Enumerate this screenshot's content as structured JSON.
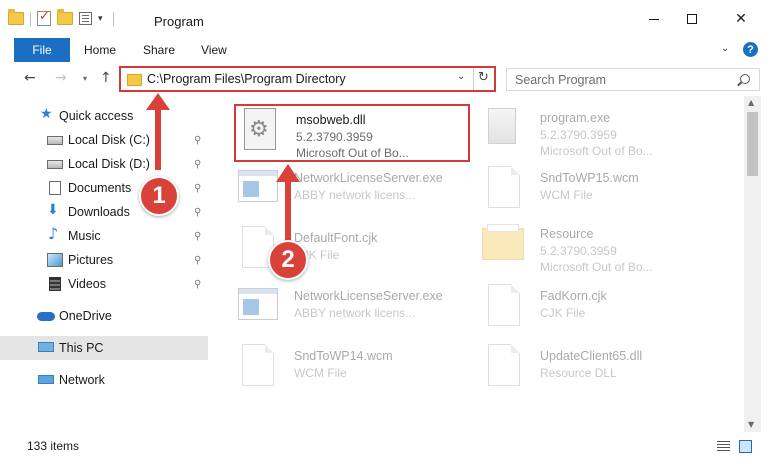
{
  "window": {
    "title": "Program",
    "minimize_label": "",
    "maximize_label": "",
    "close_label": "✕"
  },
  "ribbon": {
    "tabs": [
      "File",
      "Home",
      "Share",
      "View"
    ]
  },
  "navigation": {
    "back": "←",
    "forward": "→",
    "recent": "⌄",
    "up": "↑",
    "address_path": "C:\\Program Files\\Program Directory",
    "refresh": "↻",
    "dropdown": "⌄",
    "search_placeholder": "Search Program"
  },
  "sidebar": {
    "items": [
      {
        "label": "Quick access",
        "icon": "star-icon",
        "pinned": false
      },
      {
        "label": "Local Disk (C:)",
        "icon": "disk-icon",
        "pinned": true
      },
      {
        "label": "Local Disk (D:)",
        "icon": "disk-icon",
        "pinned": true
      },
      {
        "label": "Documents",
        "icon": "documents-icon",
        "pinned": true
      },
      {
        "label": "Downloads",
        "icon": "downloads-icon",
        "pinned": true
      },
      {
        "label": "Music",
        "icon": "music-icon",
        "pinned": true
      },
      {
        "label": "Pictures",
        "icon": "pictures-icon",
        "pinned": true
      },
      {
        "label": "Videos",
        "icon": "videos-icon",
        "pinned": true
      },
      {
        "label": "OneDrive",
        "icon": "onedrive-icon",
        "pinned": false
      },
      {
        "label": "This PC",
        "icon": "this-pc-icon",
        "pinned": false,
        "selected": true
      },
      {
        "label": "Network",
        "icon": "network-icon",
        "pinned": false
      }
    ],
    "pin_glyph": "📌"
  },
  "files": [
    {
      "name": "msobweb.dll",
      "line1": "5.2.3790.3959",
      "line2": "Microsoft Out of Bo...",
      "icon": "dll-icon",
      "highlighted": true
    },
    {
      "name": "program.exe",
      "line1": "5.2.3790.3959",
      "line2": "Microsoft Out of Bo...",
      "icon": "program-icon",
      "highlighted": false
    },
    {
      "name": "NetworkLicenseServer.exe",
      "line1": "ABBY network licens...",
      "line2": "",
      "icon": "exe-icon",
      "highlighted": false
    },
    {
      "name": "SndToWP15.wcm",
      "line1": "WCM File",
      "line2": "",
      "icon": "document-icon",
      "highlighted": false
    },
    {
      "name": "DefaultFont.cjk",
      "line1": "CJK File",
      "line2": "",
      "icon": "document-icon",
      "highlighted": false
    },
    {
      "name": "Resource",
      "line1": "5.2.3790.3959",
      "line2": "Microsoft Out of Bo...",
      "icon": "folder-icon",
      "highlighted": false
    },
    {
      "name": "NetworkLicenseServer.exe",
      "line1": "ABBY network licens...",
      "line2": "",
      "icon": "exe-icon",
      "highlighted": false
    },
    {
      "name": "FadKorn.cjk",
      "line1": "CJK File",
      "line2": "",
      "icon": "document-icon",
      "highlighted": false
    },
    {
      "name": "SndToWP14.wcm",
      "line1": "WCM File",
      "line2": "",
      "icon": "document-icon",
      "highlighted": false
    },
    {
      "name": "UpdateClient65.dll",
      "line1": "Resource DLL",
      "line2": "",
      "icon": "document-icon",
      "highlighted": false
    }
  ],
  "status": {
    "item_count": "133 items"
  },
  "callouts": {
    "step1": "1",
    "step2": "2"
  },
  "colors": {
    "accent": "#1a6fc3",
    "highlight_red": "#d33a3a",
    "callout_red": "#d8423a"
  }
}
